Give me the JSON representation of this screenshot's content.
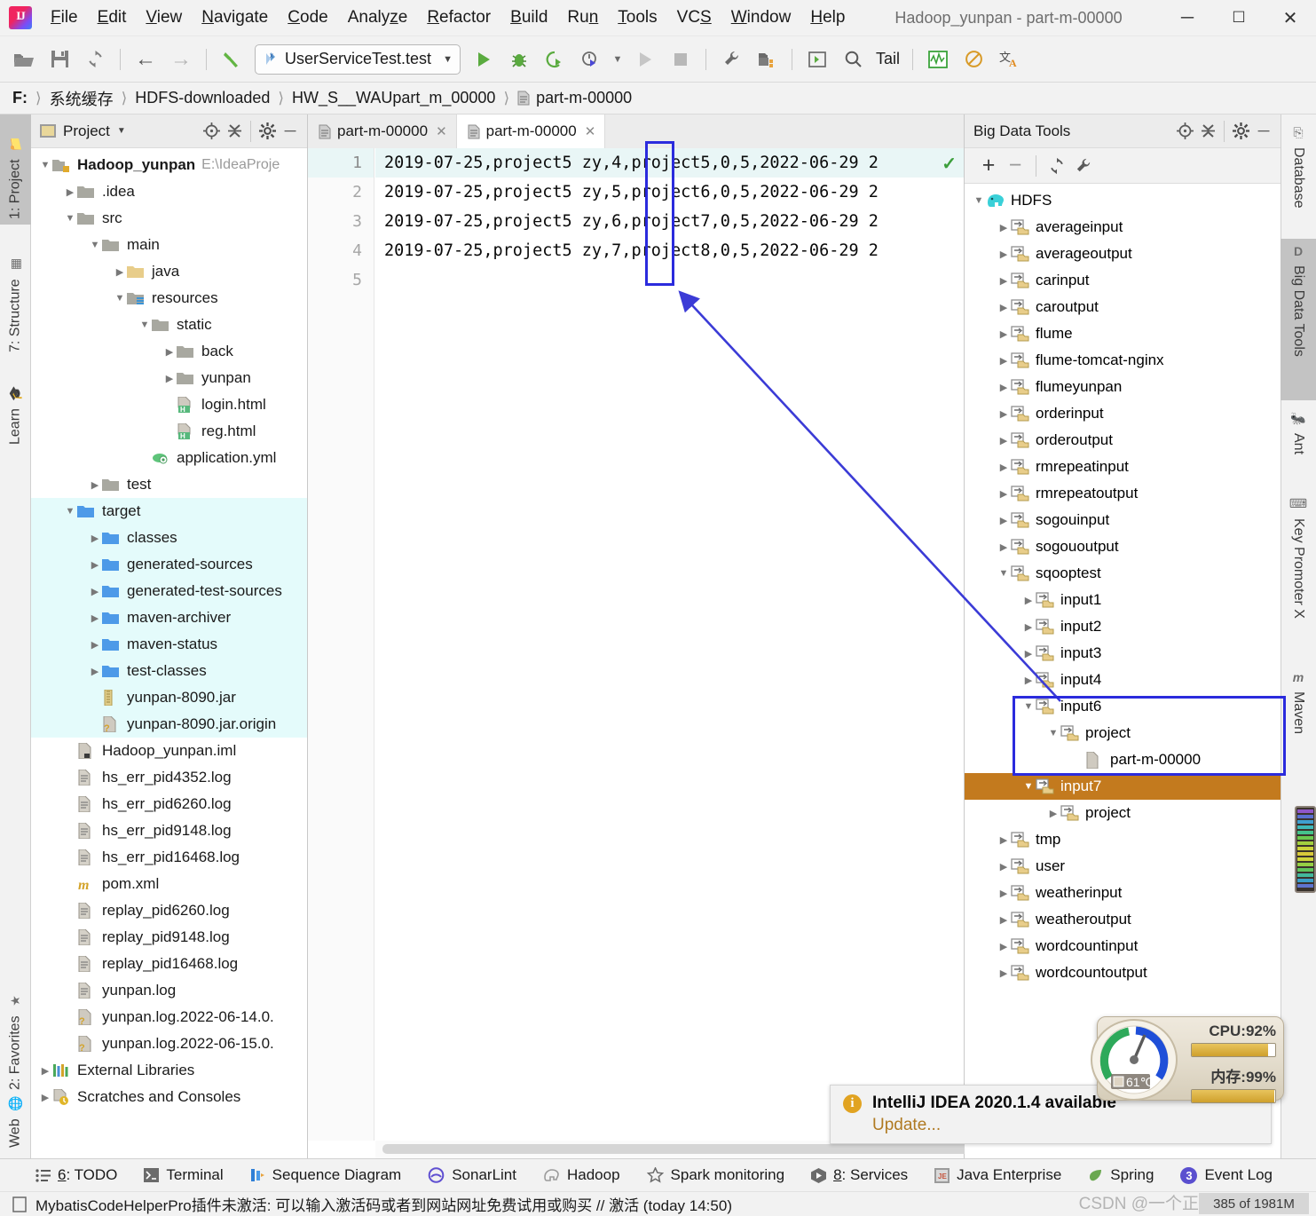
{
  "window": {
    "title": "Hadoop_yunpan - part-m-00000",
    "minimize": "─",
    "maximize": "☐",
    "close": "✕"
  },
  "menu": {
    "items": [
      {
        "label": "File",
        "mn": "F"
      },
      {
        "label": "Edit",
        "mn": "E"
      },
      {
        "label": "View",
        "mn": "V"
      },
      {
        "label": "Navigate",
        "mn": "N"
      },
      {
        "label": "Code",
        "mn": "C"
      },
      {
        "label": "Analyze",
        "mn": "z"
      },
      {
        "label": "Refactor",
        "mn": "R"
      },
      {
        "label": "Build",
        "mn": "B"
      },
      {
        "label": "Run",
        "mn": "n"
      },
      {
        "label": "Tools",
        "mn": "T"
      },
      {
        "label": "VCS",
        "mn": "S"
      },
      {
        "label": "Window",
        "mn": "W"
      },
      {
        "label": "Help",
        "mn": "H"
      }
    ]
  },
  "toolbar": {
    "run_config": "UserServiceTest.test",
    "tail_label": "Tail",
    "icons": [
      "open-folder-icon",
      "save-icon",
      "sync-icon",
      "back-arrow-icon",
      "forward-arrow-icon",
      "build-hammer-icon",
      "run-icon",
      "debug-icon",
      "run-coverage-icon",
      "profile-icon",
      "run-disabled-icon",
      "stop-icon",
      "settings-wrench-icon",
      "project-structure-icon",
      "console-icon",
      "search-icon",
      "monitor-icon",
      "no-entry-icon",
      "translate-icon"
    ]
  },
  "breadcrumb": {
    "items": [
      "F:",
      "系统缓存",
      "HDFS-downloaded",
      "HW_S__WAUpart_m_00000",
      "part-m-00000"
    ]
  },
  "left_strip": {
    "tabs": [
      {
        "label": "1: Project",
        "icon": "project-folder-icon",
        "selected": true
      },
      {
        "label": "7: Structure",
        "icon": "structure-icon",
        "selected": false
      },
      {
        "label": "Learn",
        "icon": "graduation-cap-icon",
        "selected": false
      },
      {
        "label": "2: Favorites",
        "icon": "star-icon",
        "selected": false
      },
      {
        "label": "Web",
        "icon": "globe-icon",
        "selected": false
      }
    ]
  },
  "right_strip": {
    "tabs": [
      {
        "label": "Database",
        "icon": "database-icon",
        "selected": false
      },
      {
        "label": "Big Data Tools",
        "icon": "bigdata-d-icon",
        "selected": true
      },
      {
        "label": "Ant",
        "icon": "ant-icon",
        "selected": false
      },
      {
        "label": "Key Promoter X",
        "icon": "key-promoter-icon",
        "selected": false
      },
      {
        "label": "Maven",
        "icon": "maven-m-icon",
        "selected": false
      }
    ]
  },
  "project_panel": {
    "title": "Project",
    "tools": [
      "locate-icon",
      "collapse-all-icon",
      "settings-gear-icon",
      "hide-icon"
    ],
    "tree": [
      {
        "label": "Hadoop_yunpan",
        "suffix": "E:\\IdeaProje",
        "depth": 0,
        "arrow": "down",
        "icon": "module-folder",
        "bold": true,
        "hl": false
      },
      {
        "label": ".idea",
        "depth": 1,
        "arrow": "right",
        "icon": "folder-gray",
        "hl": false
      },
      {
        "label": "src",
        "depth": 1,
        "arrow": "down",
        "icon": "folder-gray",
        "hl": false
      },
      {
        "label": "main",
        "depth": 2,
        "arrow": "down",
        "icon": "folder-gray",
        "hl": false
      },
      {
        "label": "java",
        "depth": 3,
        "arrow": "right",
        "icon": "folder-source",
        "hl": false
      },
      {
        "label": "resources",
        "depth": 3,
        "arrow": "down",
        "icon": "folder-resources",
        "hl": false
      },
      {
        "label": "static",
        "depth": 4,
        "arrow": "down",
        "icon": "folder-gray",
        "hl": false
      },
      {
        "label": "back",
        "depth": 5,
        "arrow": "right",
        "icon": "folder-gray",
        "hl": false
      },
      {
        "label": "yunpan",
        "depth": 5,
        "arrow": "right",
        "icon": "folder-gray",
        "hl": false
      },
      {
        "label": "login.html",
        "depth": 5,
        "arrow": "none",
        "icon": "html-file",
        "hl": false
      },
      {
        "label": "reg.html",
        "depth": 5,
        "arrow": "none",
        "icon": "html-file",
        "hl": false
      },
      {
        "label": "application.yml",
        "depth": 4,
        "arrow": "none",
        "icon": "yml-file",
        "hl": false
      },
      {
        "label": "test",
        "depth": 2,
        "arrow": "right",
        "icon": "folder-gray",
        "hl": false
      },
      {
        "label": "target",
        "depth": 1,
        "arrow": "down",
        "icon": "folder-blue",
        "hl": true
      },
      {
        "label": "classes",
        "depth": 2,
        "arrow": "right",
        "icon": "folder-blue",
        "hl": true
      },
      {
        "label": "generated-sources",
        "depth": 2,
        "arrow": "right",
        "icon": "folder-blue",
        "hl": true
      },
      {
        "label": "generated-test-sources",
        "depth": 2,
        "arrow": "right",
        "icon": "folder-blue",
        "hl": true
      },
      {
        "label": "maven-archiver",
        "depth": 2,
        "arrow": "right",
        "icon": "folder-blue",
        "hl": true
      },
      {
        "label": "maven-status",
        "depth": 2,
        "arrow": "right",
        "icon": "folder-blue",
        "hl": true
      },
      {
        "label": "test-classes",
        "depth": 2,
        "arrow": "right",
        "icon": "folder-blue",
        "hl": true
      },
      {
        "label": "yunpan-8090.jar",
        "depth": 2,
        "arrow": "none",
        "icon": "jar-file",
        "hl": true
      },
      {
        "label": "yunpan-8090.jar.origin",
        "depth": 2,
        "arrow": "none",
        "icon": "unknown-file",
        "hl": true
      },
      {
        "label": "Hadoop_yunpan.iml",
        "depth": 1,
        "arrow": "none",
        "icon": "iml-file",
        "hl": false
      },
      {
        "label": "hs_err_pid4352.log",
        "depth": 1,
        "arrow": "none",
        "icon": "log-file",
        "hl": false
      },
      {
        "label": "hs_err_pid6260.log",
        "depth": 1,
        "arrow": "none",
        "icon": "log-file",
        "hl": false
      },
      {
        "label": "hs_err_pid9148.log",
        "depth": 1,
        "arrow": "none",
        "icon": "log-file",
        "hl": false
      },
      {
        "label": "hs_err_pid16468.log",
        "depth": 1,
        "arrow": "none",
        "icon": "log-file",
        "hl": false
      },
      {
        "label": "pom.xml",
        "depth": 1,
        "arrow": "none",
        "icon": "maven-file",
        "hl": false
      },
      {
        "label": "replay_pid6260.log",
        "depth": 1,
        "arrow": "none",
        "icon": "log-file",
        "hl": false
      },
      {
        "label": "replay_pid9148.log",
        "depth": 1,
        "arrow": "none",
        "icon": "log-file",
        "hl": false
      },
      {
        "label": "replay_pid16468.log",
        "depth": 1,
        "arrow": "none",
        "icon": "log-file",
        "hl": false
      },
      {
        "label": "yunpan.log",
        "depth": 1,
        "arrow": "none",
        "icon": "log-file",
        "hl": false
      },
      {
        "label": "yunpan.log.2022-06-14.0.",
        "depth": 1,
        "arrow": "none",
        "icon": "unknown-file",
        "hl": false
      },
      {
        "label": "yunpan.log.2022-06-15.0.",
        "depth": 1,
        "arrow": "none",
        "icon": "unknown-file",
        "hl": false
      },
      {
        "label": "External Libraries",
        "depth": 0,
        "arrow": "right",
        "icon": "libraries-icon",
        "hl": false
      },
      {
        "label": "Scratches and Consoles",
        "depth": 0,
        "arrow": "right",
        "icon": "scratches-icon",
        "hl": false
      }
    ]
  },
  "editor": {
    "tabs": [
      {
        "label": "part-m-00000",
        "active": false
      },
      {
        "label": "part-m-00000",
        "active": true
      }
    ],
    "line_numbers": [
      "1",
      "2",
      "3",
      "4",
      "5"
    ],
    "lines": [
      "2019-07-25,project5 zy,4,project5,0,5,2022-06-29 2",
      "2019-07-25,project5 zy,5,project6,0,5,2022-06-29 2",
      "2019-07-25,project5 zy,6,project7,0,5,2022-06-29 2",
      "2019-07-25,project5 zy,7,project8,0,5,2022-06-29 2",
      ""
    ],
    "current_line": 1,
    "inspection_status": "ok-check-icon"
  },
  "bigdata_panel": {
    "title": "Big Data Tools",
    "head_tools": [
      "locate-icon",
      "collapse-all-icon",
      "settings-gear-icon",
      "hide-icon"
    ],
    "toolbar": [
      "add-icon",
      "remove-icon",
      "refresh-icon",
      "wrench-icon"
    ],
    "tree": [
      {
        "label": "HDFS",
        "depth": 0,
        "arrow": "down",
        "icon": "hadoop-elephant-icon",
        "sel": false
      },
      {
        "label": "averageinput",
        "depth": 1,
        "arrow": "right",
        "icon": "hdfs-folder",
        "sel": false
      },
      {
        "label": "averageoutput",
        "depth": 1,
        "arrow": "right",
        "icon": "hdfs-folder",
        "sel": false
      },
      {
        "label": "carinput",
        "depth": 1,
        "arrow": "right",
        "icon": "hdfs-folder",
        "sel": false
      },
      {
        "label": "caroutput",
        "depth": 1,
        "arrow": "right",
        "icon": "hdfs-folder",
        "sel": false
      },
      {
        "label": "flume",
        "depth": 1,
        "arrow": "right",
        "icon": "hdfs-folder",
        "sel": false
      },
      {
        "label": "flume-tomcat-nginx",
        "depth": 1,
        "arrow": "right",
        "icon": "hdfs-folder",
        "sel": false
      },
      {
        "label": "flumeyunpan",
        "depth": 1,
        "arrow": "right",
        "icon": "hdfs-folder",
        "sel": false
      },
      {
        "label": "orderinput",
        "depth": 1,
        "arrow": "right",
        "icon": "hdfs-folder",
        "sel": false
      },
      {
        "label": "orderoutput",
        "depth": 1,
        "arrow": "right",
        "icon": "hdfs-folder",
        "sel": false
      },
      {
        "label": "rmrepeatinput",
        "depth": 1,
        "arrow": "right",
        "icon": "hdfs-folder",
        "sel": false
      },
      {
        "label": "rmrepeatoutput",
        "depth": 1,
        "arrow": "right",
        "icon": "hdfs-folder",
        "sel": false
      },
      {
        "label": "sogouinput",
        "depth": 1,
        "arrow": "right",
        "icon": "hdfs-folder",
        "sel": false
      },
      {
        "label": "sogououtput",
        "depth": 1,
        "arrow": "right",
        "icon": "hdfs-folder",
        "sel": false
      },
      {
        "label": "sqooptest",
        "depth": 1,
        "arrow": "down",
        "icon": "hdfs-folder",
        "sel": false
      },
      {
        "label": "input1",
        "depth": 2,
        "arrow": "right",
        "icon": "hdfs-folder",
        "sel": false
      },
      {
        "label": "input2",
        "depth": 2,
        "arrow": "right",
        "icon": "hdfs-folder",
        "sel": false
      },
      {
        "label": "input3",
        "depth": 2,
        "arrow": "right",
        "icon": "hdfs-folder",
        "sel": false
      },
      {
        "label": "input4",
        "depth": 2,
        "arrow": "right",
        "icon": "hdfs-folder",
        "sel": false
      },
      {
        "label": "input6",
        "depth": 2,
        "arrow": "down",
        "icon": "hdfs-folder",
        "sel": false
      },
      {
        "label": "project",
        "depth": 3,
        "arrow": "down",
        "icon": "hdfs-folder",
        "sel": false
      },
      {
        "label": "part-m-00000",
        "depth": 4,
        "arrow": "none",
        "icon": "hdfs-file",
        "sel": false
      },
      {
        "label": "input7",
        "depth": 2,
        "arrow": "down",
        "icon": "hdfs-folder",
        "sel": true
      },
      {
        "label": "project",
        "depth": 3,
        "arrow": "right",
        "icon": "hdfs-folder",
        "sel": false
      },
      {
        "label": "tmp",
        "depth": 1,
        "arrow": "right",
        "icon": "hdfs-folder",
        "sel": false
      },
      {
        "label": "user",
        "depth": 1,
        "arrow": "right",
        "icon": "hdfs-folder",
        "sel": false
      },
      {
        "label": "weatherinput",
        "depth": 1,
        "arrow": "right",
        "icon": "hdfs-folder",
        "sel": false
      },
      {
        "label": "weatheroutput",
        "depth": 1,
        "arrow": "right",
        "icon": "hdfs-folder",
        "sel": false
      },
      {
        "label": "wordcountinput",
        "depth": 1,
        "arrow": "right",
        "icon": "hdfs-folder",
        "sel": false
      },
      {
        "label": "wordcountoutput",
        "depth": 1,
        "arrow": "right",
        "icon": "hdfs-folder",
        "sel": false
      }
    ]
  },
  "cpu_widget": {
    "cpu_label": "CPU:92%",
    "cpu_percent": 92,
    "mem_label": "内存:99%",
    "mem_percent": 99,
    "temperature": "61℃"
  },
  "notification": {
    "title": "IntelliJ IDEA 2020.1.4 available",
    "link": "Update...",
    "icon": "info-icon"
  },
  "status_bar": {
    "items": [
      {
        "label": "6: TODO",
        "icon": "todo-list-icon",
        "mn": "6"
      },
      {
        "label": "Terminal",
        "icon": "terminal-icon"
      },
      {
        "label": "Sequence Diagram",
        "icon": "sequence-diagram-icon"
      },
      {
        "label": "SonarLint",
        "icon": "sonarlint-icon"
      },
      {
        "label": "Hadoop",
        "icon": "hadoop-elephant-icon"
      },
      {
        "label": "Spark monitoring",
        "icon": "spark-star-icon"
      },
      {
        "label": "8: Services",
        "icon": "services-icon",
        "mn": "8"
      },
      {
        "label": "Java Enterprise",
        "icon": "java-enterprise-icon"
      },
      {
        "label": "Spring",
        "icon": "spring-leaf-icon"
      },
      {
        "label": "Event Log",
        "icon": "event-log-icon",
        "badge": "3"
      }
    ]
  },
  "info_bar": {
    "message": "MybatisCodeHelperPro插件未激活: 可以输入激活码或者到网站网址免费试用或购买 // 激活 (today 14:50)",
    "memory": "385 of 1981M",
    "watermark": "CSDN @一个正在努力的菜鸡"
  }
}
